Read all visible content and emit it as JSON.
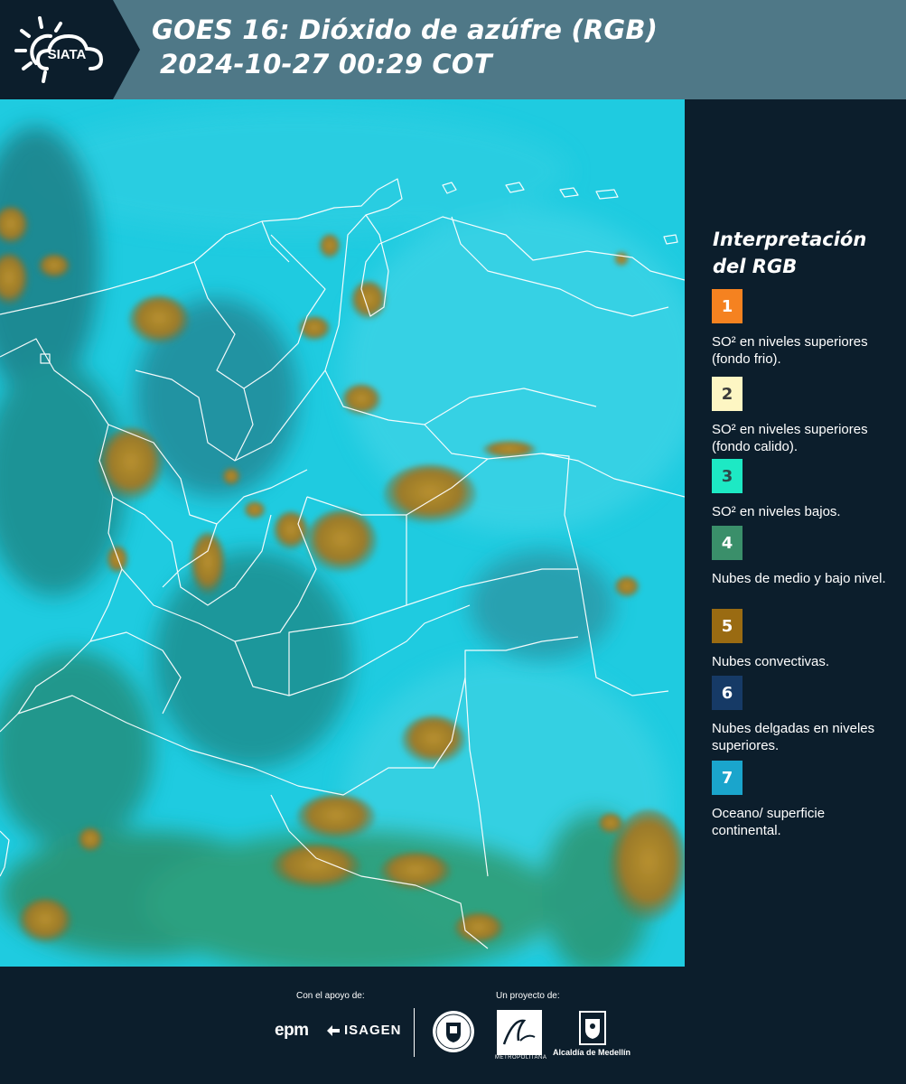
{
  "header": {
    "logo_text": "SIATA",
    "title_line1": "GOES 16: Dióxido de azúfre (RGB)",
    "title_line2": "2024-10-27 00:29 COT"
  },
  "legend": {
    "title": "Interpretación del RGB",
    "items": [
      {
        "number": "1",
        "label": "SO² en niveles superiores (fondo frio).",
        "color": "#f58220",
        "text_color": "#ffffff"
      },
      {
        "number": "2",
        "label": "SO² en niveles superiores (fondo calido).",
        "color": "#fdf6c3",
        "text_color": "#3a3a3a"
      },
      {
        "number": "3",
        "label": "SO² en niveles bajos.",
        "color": "#1de9c4",
        "text_color": "#2d4a4a"
      },
      {
        "number": "4",
        "label": "Nubes de medio y bajo nivel.",
        "color": "#3a8f6a",
        "text_color": "#ffffff"
      },
      {
        "number": "5",
        "label": "Nubes convectivas.",
        "color": "#9a6b12",
        "text_color": "#ffffff"
      },
      {
        "number": "6",
        "label": "Nubes delgadas en niveles superiores.",
        "color": "#163a66",
        "text_color": "#ffffff"
      },
      {
        "number": "7",
        "label": "Oceano/ superficie continental.",
        "color": "#1aa5cc",
        "text_color": "#ffffff"
      }
    ]
  },
  "footer": {
    "support_label": "Con el apoyo de:",
    "project_label": "Un proyecto de:",
    "epm": "epm",
    "isagen": "ISAGEN",
    "area_metropolitana": "METROPOLITANA",
    "alcaldia": "Alcaldía de Medellín"
  },
  "colors": {
    "background": "#0c1e2c",
    "header": "#4f7887",
    "ocean": "#1fc8dd",
    "convective": "#9a7a2a"
  }
}
